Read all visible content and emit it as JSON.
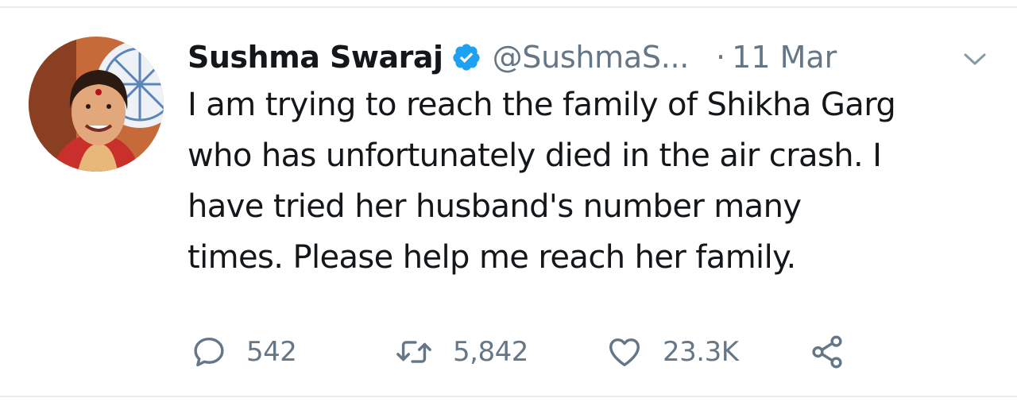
{
  "tweet": {
    "author_name": "Sushma Swaraj",
    "verified_icon": "verified-badge-icon",
    "handle": "@SushmaS...",
    "separator": "·",
    "timestamp": "11 Mar",
    "menu_icon": "chevron-down-icon",
    "text": "I am trying to reach the family of Shikha Garg\nwho has unfortunately died in the air crash. I\nhave tried her husband's number many\ntimes. Please help me reach her family."
  },
  "actions": {
    "reply": {
      "icon": "reply-icon",
      "count": "542"
    },
    "retweet": {
      "icon": "retweet-icon",
      "count": "5,842"
    },
    "like": {
      "icon": "heart-icon",
      "count": "23.3K"
    },
    "share": {
      "icon": "share-icon"
    }
  },
  "colors": {
    "text": "#14171a",
    "secondary": "#657786",
    "verified": "#1da1f2",
    "divider": "#e6ecf0"
  }
}
